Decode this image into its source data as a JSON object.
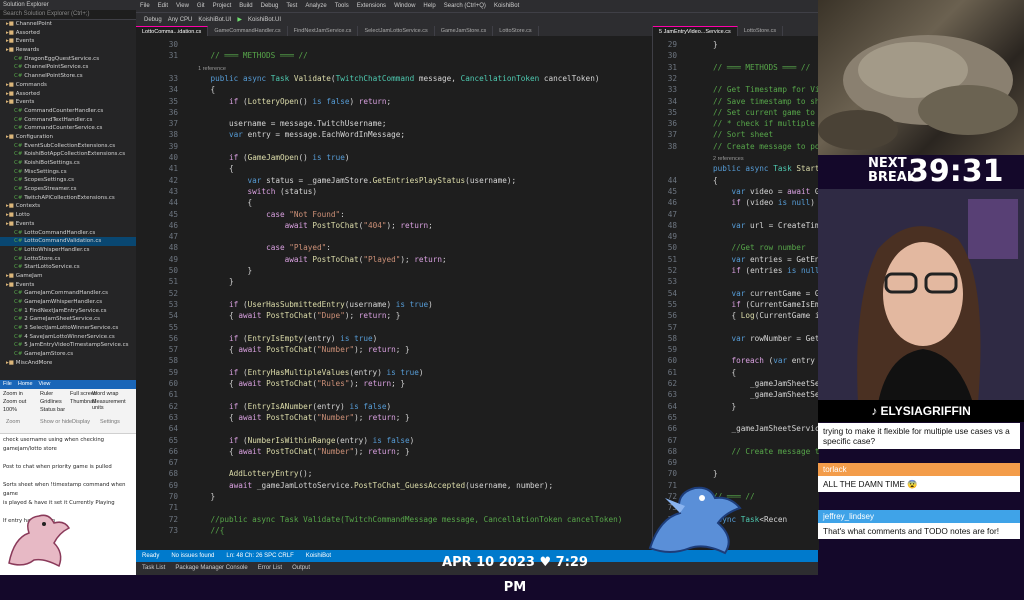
{
  "solution_explorer": {
    "title": "Solution Explorer",
    "search_placeholder": "Search Solution Explorer (Ctrl+;)",
    "items": [
      {
        "label": "ChannelPoint",
        "type": "folder"
      },
      {
        "label": "Assorted",
        "type": "folder"
      },
      {
        "label": "Events",
        "type": "folder"
      },
      {
        "label": "Rewards",
        "type": "folder"
      },
      {
        "label": "DragonEggQuestService.cs",
        "type": "file"
      },
      {
        "label": "ChannelPointService.cs",
        "type": "file"
      },
      {
        "label": "ChannelPointStore.cs",
        "type": "file"
      },
      {
        "label": "Commands",
        "type": "folder"
      },
      {
        "label": "Assorted",
        "type": "folder"
      },
      {
        "label": "Events",
        "type": "folder"
      },
      {
        "label": "CommandCounterHandler.cs",
        "type": "file"
      },
      {
        "label": "CommandTextHandler.cs",
        "type": "file"
      },
      {
        "label": "CommandCounterService.cs",
        "type": "file"
      },
      {
        "label": "Configuration",
        "type": "folder"
      },
      {
        "label": "EventSubCollectionExtensions.cs",
        "type": "file"
      },
      {
        "label": "KoishiBotAppCollectionExtensions.cs",
        "type": "file"
      },
      {
        "label": "KoishiBotSettings.cs",
        "type": "file"
      },
      {
        "label": "MiscSettings.cs",
        "type": "file"
      },
      {
        "label": "ScopesSettings.cs",
        "type": "file"
      },
      {
        "label": "ScopesStreamer.cs",
        "type": "file"
      },
      {
        "label": "TwitchAPICollectionExtensions.cs",
        "type": "file"
      },
      {
        "label": "Contexts",
        "type": "folder"
      },
      {
        "label": "Lotto",
        "type": "folder"
      },
      {
        "label": "Events",
        "type": "folder"
      },
      {
        "label": "LottoCommandHandler.cs",
        "type": "file"
      },
      {
        "label": "LottoCommandValidation.cs",
        "type": "file",
        "selected": true
      },
      {
        "label": "LottoWhisperHandler.cs",
        "type": "file"
      },
      {
        "label": "LottoStore.cs",
        "type": "file"
      },
      {
        "label": "StartLottoService.cs",
        "type": "file"
      },
      {
        "label": "GameJam",
        "type": "folder"
      },
      {
        "label": "Events",
        "type": "folder"
      },
      {
        "label": "GameJamCommandHandler.cs",
        "type": "file"
      },
      {
        "label": "GameJamWhisperHandler.cs",
        "type": "file"
      },
      {
        "label": "1 FindNextJamEntryService.cs",
        "type": "file"
      },
      {
        "label": "2 GameJamSheetService.cs",
        "type": "file"
      },
      {
        "label": "3 SelectJamLottoWinnerService.cs",
        "type": "file"
      },
      {
        "label": "4 SaveJamLottoWinnerService.cs",
        "type": "file"
      },
      {
        "label": "5 JamEntryVideoTimestampService.cs",
        "type": "file"
      },
      {
        "label": "GameJamStore.cs",
        "type": "file"
      },
      {
        "label": "MiscAndMore",
        "type": "folder"
      }
    ]
  },
  "paint": {
    "tabs": [
      "File",
      "Home",
      "View"
    ],
    "ribbon": [
      "Zoom in",
      "Zoom out",
      "100%",
      "Ruler",
      "Gridlines",
      "Status bar",
      "Full screen",
      "Thumbnail",
      "Word wrap",
      "Measurement units"
    ],
    "groups": [
      "Zoom",
      "Show or hide",
      "Display",
      "Settings"
    ],
    "notes": [
      "check username using when checking",
      "gamejam/lotto store",
      "",
      "Post to chat when priority game is pulled",
      "",
      "Sorts sheet when !timestamp command when game",
      "is played & have it set it Currently Playing",
      "",
      "If entry has \"Curren"
    ]
  },
  "menubar": [
    "File",
    "Edit",
    "View",
    "Git",
    "Project",
    "Build",
    "Debug",
    "Test",
    "Analyze",
    "Tools",
    "Extensions",
    "Window",
    "Help",
    "Search (Ctrl+Q)",
    "KoishiBot"
  ],
  "toolbar": [
    "Debug",
    "Any CPU",
    "KoishiBot.UI",
    "KoishiBot.UI"
  ],
  "tabs_left": [
    "LottoComma...idation.cs",
    "GameCommandHandler.cs",
    "FindNextJamService.cs",
    "SelectJamLottoService.cs",
    "GameJamStore.cs",
    "LottoStore.cs"
  ],
  "tabs_right": [
    "5 JamEntryVideo...Service.cs",
    "LottoStore.cs"
  ],
  "code_left": [
    {
      "n": "30",
      "t": ""
    },
    {
      "n": "31",
      "t": "    // ═══ METHODS ═══ //"
    },
    {
      "n": "",
      "t": "    1 reference"
    },
    {
      "n": "33",
      "t": "    public async Task Validate(TwitchChatCommand message, CancellationToken cancelToken)"
    },
    {
      "n": "34",
      "t": "    {"
    },
    {
      "n": "35",
      "t": "        if (LotteryOpen() is false) return;"
    },
    {
      "n": "36",
      "t": ""
    },
    {
      "n": "37",
      "t": "        username = message.TwitchUsername;"
    },
    {
      "n": "38",
      "t": "        var entry = message.EachWordInMessage;"
    },
    {
      "n": "39",
      "t": ""
    },
    {
      "n": "40",
      "t": "        if (GameJamOpen() is true)"
    },
    {
      "n": "41",
      "t": "        {"
    },
    {
      "n": "42",
      "t": "            var status = _gameJamStore.GetEntriesPlayStatus(username);"
    },
    {
      "n": "43",
      "t": "            switch (status)"
    },
    {
      "n": "44",
      "t": "            {"
    },
    {
      "n": "45",
      "t": "                case \"Not Found\":"
    },
    {
      "n": "46",
      "t": "                    await PostToChat(\"404\"); return;"
    },
    {
      "n": "47",
      "t": ""
    },
    {
      "n": "48",
      "t": "                case \"Played\":"
    },
    {
      "n": "49",
      "t": "                    await PostToChat(\"Played\"); return;"
    },
    {
      "n": "50",
      "t": "            }"
    },
    {
      "n": "51",
      "t": "        }"
    },
    {
      "n": "52",
      "t": ""
    },
    {
      "n": "53",
      "t": "        if (UserHasSubmittedEntry(username) is true)"
    },
    {
      "n": "54",
      "t": "        { await PostToChat(\"Dupe\"); return; }"
    },
    {
      "n": "55",
      "t": ""
    },
    {
      "n": "56",
      "t": "        if (EntryIsEmpty(entry) is true)"
    },
    {
      "n": "57",
      "t": "        { await PostToChat(\"Number\"); return; }"
    },
    {
      "n": "58",
      "t": ""
    },
    {
      "n": "59",
      "t": "        if (EntryHasMultipleValues(entry) is true)"
    },
    {
      "n": "60",
      "t": "        { await PostToChat(\"Rules\"); return; }"
    },
    {
      "n": "61",
      "t": ""
    },
    {
      "n": "62",
      "t": "        if (EntryIsANumber(entry) is false)"
    },
    {
      "n": "63",
      "t": "        { await PostToChat(\"Number\"); return; }"
    },
    {
      "n": "64",
      "t": ""
    },
    {
      "n": "65",
      "t": "        if (NumberIsWithinRange(entry) is false)"
    },
    {
      "n": "66",
      "t": "        { await PostToChat(\"Number\"); return; }"
    },
    {
      "n": "67",
      "t": ""
    },
    {
      "n": "68",
      "t": "        AddLotteryEntry();"
    },
    {
      "n": "69",
      "t": "        await _gameJamLottoService.PostToChat_GuessAccepted(username, number);"
    },
    {
      "n": "70",
      "t": "    }"
    },
    {
      "n": "71",
      "t": ""
    },
    {
      "n": "72",
      "t": "    //public async Task Validate(TwitchCommandMessage message, CancellationToken cancelToken)"
    },
    {
      "n": "73",
      "t": "    //{"
    }
  ],
  "code_right": [
    {
      "n": "29",
      "t": "}"
    },
    {
      "n": "30",
      "t": ""
    },
    {
      "n": "31",
      "t": "// ═══ METHODS ═══ //"
    },
    {
      "n": "32",
      "t": ""
    },
    {
      "n": "33",
      "t": "// Get Timestamp for Vi"
    },
    {
      "n": "34",
      "t": "// Save timestamp to sh"
    },
    {
      "n": "35",
      "t": "// Set current game to"
    },
    {
      "n": "36",
      "t": "// * check if multiple"
    },
    {
      "n": "37",
      "t": "// Sort sheet"
    },
    {
      "n": "38",
      "t": "// Create message to pos"
    },
    {
      "n": "",
      "t": "2 references"
    },
    {
      "n": "",
      "t": "public async Task Start(Cancell"
    },
    {
      "n": "44",
      "t": "{"
    },
    {
      "n": "45",
      "t": "    var video = await Ge"
    },
    {
      "n": "46",
      "t": "    if (video is null) {"
    },
    {
      "n": "47",
      "t": ""
    },
    {
      "n": "48",
      "t": "    var url = CreateTime"
    },
    {
      "n": "49",
      "t": ""
    },
    {
      "n": "50",
      "t": "    //Get row number"
    },
    {
      "n": "51",
      "t": "    var entries = GetEnt"
    },
    {
      "n": "52",
      "t": "    if (entries is null)"
    },
    {
      "n": "53",
      "t": ""
    },
    {
      "n": "54",
      "t": "    var currentGame = Ge"
    },
    {
      "n": "55",
      "t": "    if (CurrentGameIsEmp"
    },
    {
      "n": "56",
      "t": "    { Log(\"CurrentGame i"
    },
    {
      "n": "57",
      "t": ""
    },
    {
      "n": "58",
      "t": "    var rowNumber = GetR"
    },
    {
      "n": "59",
      "t": ""
    },
    {
      "n": "60",
      "t": "    foreach (var entry i"
    },
    {
      "n": "61",
      "t": "    {"
    },
    {
      "n": "62",
      "t": "        _gameJamSheetServ"
    },
    {
      "n": "63",
      "t": "        _gameJamSheetServ"
    },
    {
      "n": "64",
      "t": "    }"
    },
    {
      "n": "65",
      "t": ""
    },
    {
      "n": "66",
      "t": "    _gameJamSheetService"
    },
    {
      "n": "67",
      "t": ""
    },
    {
      "n": "68",
      "t": "    // Create message to"
    },
    {
      "n": "69",
      "t": ""
    },
    {
      "n": "70",
      "t": "}"
    },
    {
      "n": "71",
      "t": ""
    },
    {
      "n": "72",
      "t": "// ═══ // "
    },
    {
      "n": "73",
      "t": ""
    },
    {
      "n": "74",
      "t": "async Task<Recen"
    },
    {
      "n": "75",
      "t": ""
    }
  ],
  "status": {
    "ready": "Ready",
    "issues": "No issues found",
    "position": "Ln: 48  Ch: 26  SPC  CRLF",
    "branch": "KoishiBot"
  },
  "bottom_tabs": [
    "Task List",
    "Package Manager Console",
    "Error List",
    "Output"
  ],
  "overlay": {
    "timer_label": "NEXT BREAK",
    "timer_value": "39:31",
    "handle": "ELYSIAGRIFFIN",
    "date": "APR 10 2023 ♥ 7:29 PM",
    "chat": [
      {
        "user": "",
        "message": "trying to make it flexible for multiple use cases vs a specific case?",
        "color": "#5bc0f0"
      },
      {
        "user": "torlack",
        "message": "ALL THE DAMN TIME 😨",
        "color": "#f39c4a"
      },
      {
        "user": "jeffrey_lindsey",
        "message": "That's what comments and TODO notes are for!",
        "color": "#3fa3e8"
      }
    ]
  }
}
